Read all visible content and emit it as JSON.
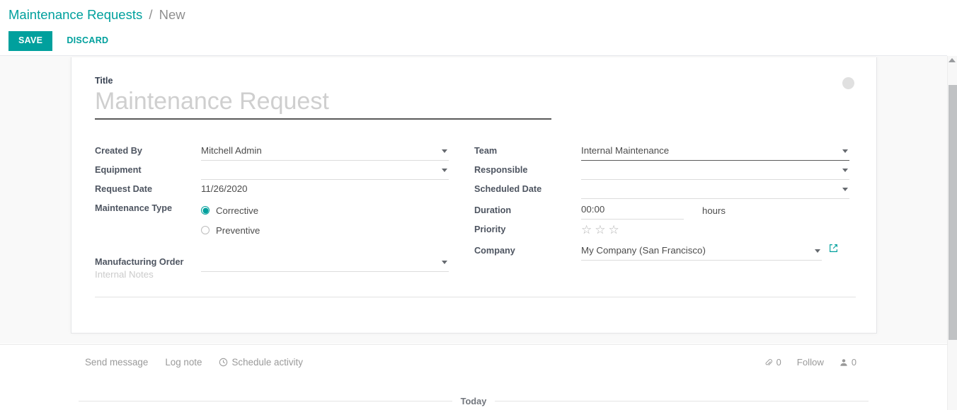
{
  "breadcrumb": {
    "root": "Maintenance Requests",
    "separator": "/",
    "current": "New"
  },
  "toolbar": {
    "save_label": "SAVE",
    "discard_label": "DISCARD"
  },
  "form": {
    "title": {
      "label": "Title",
      "value": "",
      "placeholder": "Maintenance Request"
    },
    "left_fields": {
      "created_by": {
        "label": "Created By",
        "value": "Mitchell Admin"
      },
      "equipment": {
        "label": "Equipment",
        "value": ""
      },
      "request_date": {
        "label": "Request Date",
        "value": "11/26/2020"
      },
      "maintenance_type": {
        "label": "Maintenance Type",
        "options": [
          {
            "label": "Corrective",
            "selected": true
          },
          {
            "label": "Preventive",
            "selected": false
          }
        ]
      },
      "manufacturing_order": {
        "label": "Manufacturing Order",
        "value": ""
      }
    },
    "right_fields": {
      "team": {
        "label": "Team",
        "value": "Internal Maintenance"
      },
      "responsible": {
        "label": "Responsible",
        "value": ""
      },
      "scheduled_date": {
        "label": "Scheduled Date",
        "value": ""
      },
      "duration": {
        "label": "Duration",
        "value": "00:00",
        "suffix": "hours"
      },
      "priority": {
        "label": "Priority",
        "stars_total": 3,
        "stars_filled": 0
      },
      "company": {
        "label": "Company",
        "value": "My Company (San Francisco)"
      }
    },
    "notes": {
      "placeholder": "Internal Notes",
      "value": ""
    }
  },
  "chatter": {
    "send_message": "Send message",
    "log_note": "Log note",
    "schedule_activity": "Schedule activity",
    "attachment_count": "0",
    "follow_label": "Follow",
    "follower_count": "0",
    "today_label": "Today"
  },
  "icons": {
    "clock": "clock-icon",
    "paperclip": "paperclip-icon",
    "user": "user-icon",
    "external_link": "external-link-icon",
    "chevron_down": "chevron-down-icon",
    "star": "star-icon"
  },
  "colors": {
    "accent": "#00a09d",
    "label": "#4e5561",
    "value": "#4c4c4c",
    "muted": "#9a9a9a"
  }
}
